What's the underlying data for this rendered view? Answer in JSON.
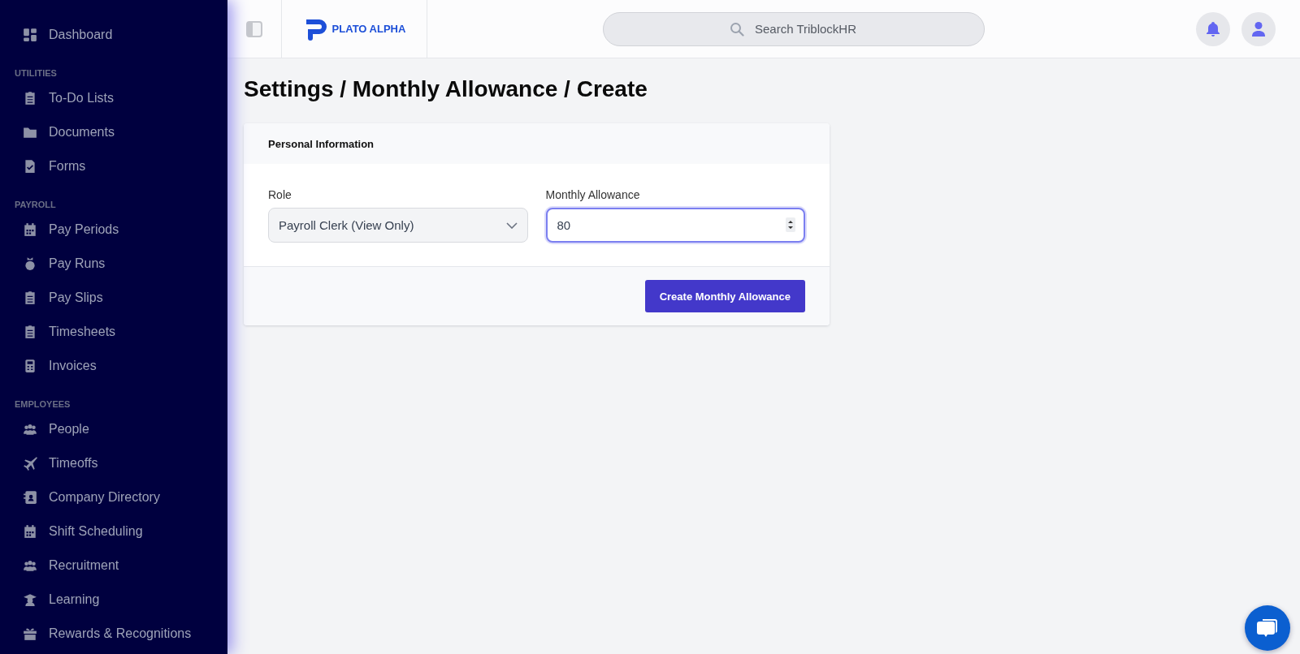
{
  "sidebar": {
    "items": [
      {
        "label": "Dashboard"
      }
    ],
    "sections": [
      {
        "title": "UTILITIES",
        "items": [
          {
            "label": "To-Do Lists"
          },
          {
            "label": "Documents"
          },
          {
            "label": "Forms"
          }
        ]
      },
      {
        "title": "PAYROLL",
        "items": [
          {
            "label": "Pay Periods"
          },
          {
            "label": "Pay Runs"
          },
          {
            "label": "Pay Slips"
          },
          {
            "label": "Timesheets"
          },
          {
            "label": "Invoices"
          }
        ]
      },
      {
        "title": "EMPLOYEES",
        "items": [
          {
            "label": "People"
          },
          {
            "label": "Timeoffs"
          },
          {
            "label": "Company Directory"
          },
          {
            "label": "Shift Scheduling"
          },
          {
            "label": "Recruitment"
          },
          {
            "label": "Learning"
          },
          {
            "label": "Rewards & Recognitions"
          }
        ]
      }
    ]
  },
  "header": {
    "logo": "PLATO ALPHA",
    "search": {
      "placeholder": "Search TriblockHR"
    }
  },
  "page_title": "Settings / Monthly Allowance / Create",
  "card": {
    "title": "Personal Information",
    "fields": [
      {
        "kind": "select",
        "label": "Role",
        "value": "Payroll Clerk (View Only)",
        "focused": false
      },
      {
        "kind": "number",
        "label": "Monthly Allowance",
        "value": "80",
        "focused": true
      }
    ],
    "submit": "Create Monthly Allowance"
  }
}
